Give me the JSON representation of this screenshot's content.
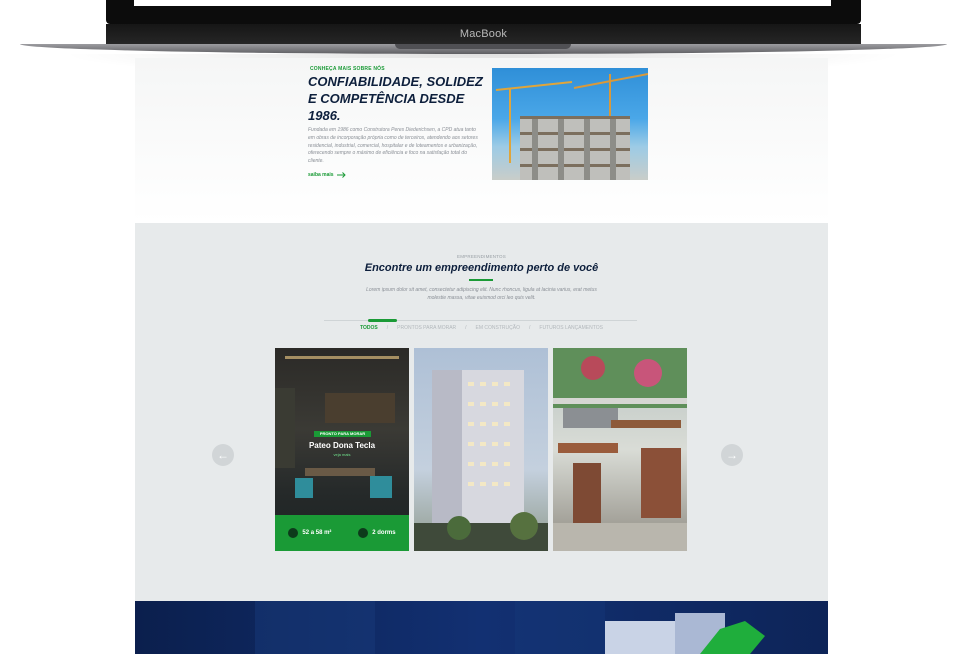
{
  "device": {
    "brand_label": "MacBook"
  },
  "about": {
    "eyebrow": "CONHEÇA MAIS SOBRE NÓS",
    "title": "CONFIABILIDADE, SOLIDEZ E COMPETÊNCIA DESDE 1986.",
    "text": "Fundada em 1986 como Construtora Peres Diederichsen, a CPD atua tanto em obras de incorporação própria como de terceiros, atendendo aos setores residencial, industrial, comercial, hospitalar e de loteamentos e urbanização, oferecendo sempre o máximo de eficiência e foco na satisfação total do cliente.",
    "link_label": "saiba mais"
  },
  "listing": {
    "eyebrow": "EMPREENDIMENTOS",
    "title": "Encontre um empreendimento perto de você",
    "text": "Lorem ipsum dolor sit amet, consectetur adipiscing elit. Nunc rhoncus, ligula at lacinia varius, erat metus molestie massa, vitae euismod orci leo quis velit.",
    "filters": [
      "TODOS",
      "PRONTOS PARA MORAR",
      "EM CONSTRUÇÃO",
      "FUTUROS LANÇAMENTOS"
    ],
    "separator": "/",
    "card": {
      "badge": "PRONTO PARA MORAR",
      "name": "Pateo Dona Tecla",
      "link": "veja mais",
      "area": "52 a 58 m²",
      "rooms": "2 dorms"
    }
  },
  "colors": {
    "accent": "#1a9a36",
    "navy": "#0d1f3c"
  }
}
